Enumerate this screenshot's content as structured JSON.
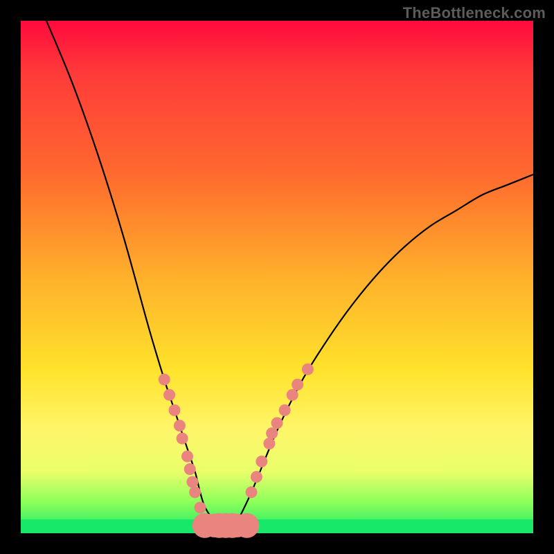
{
  "watermark": "TheBottleneck.com",
  "chart_data": {
    "type": "line",
    "title": "",
    "xlabel": "",
    "ylabel": "",
    "xlim": [
      0,
      100
    ],
    "ylim": [
      0,
      100
    ],
    "grid": false,
    "legend": false,
    "series": [
      {
        "name": "curve",
        "color": "#000000",
        "x": [
          5,
          10,
          15,
          20,
          25,
          28,
          30,
          32,
          34,
          35,
          36,
          38,
          40,
          42,
          45,
          50,
          55,
          60,
          65,
          70,
          75,
          80,
          85,
          90,
          95,
          100
        ],
        "y": [
          100,
          88,
          74,
          58,
          40,
          30,
          24,
          18,
          12,
          8,
          5,
          2,
          0,
          2,
          8,
          20,
          30,
          38,
          45,
          51,
          56,
          60,
          63,
          66,
          68,
          70
        ]
      },
      {
        "name": "dots",
        "type": "scatter",
        "color": "#e9847f",
        "markers": [
          {
            "x": 28.0,
            "y": 30.0
          },
          {
            "x": 29.0,
            "y": 27.0
          },
          {
            "x": 30.0,
            "y": 24.0
          },
          {
            "x": 31.0,
            "y": 21.0
          },
          {
            "x": 31.5,
            "y": 18.5
          },
          {
            "x": 32.5,
            "y": 15.0
          },
          {
            "x": 33.0,
            "y": 12.5
          },
          {
            "x": 33.5,
            "y": 10.0
          },
          {
            "x": 34.0,
            "y": 8.0
          },
          {
            "x": 35.0,
            "y": 5.0
          },
          {
            "x": 45.0,
            "y": 8.0
          },
          {
            "x": 46.0,
            "y": 11.0
          },
          {
            "x": 47.0,
            "y": 14.0
          },
          {
            "x": 48.5,
            "y": 17.5
          },
          {
            "x": 49.0,
            "y": 19.5
          },
          {
            "x": 50.0,
            "y": 21.5
          },
          {
            "x": 51.5,
            "y": 24.0
          },
          {
            "x": 53.0,
            "y": 27.0
          },
          {
            "x": 54.0,
            "y": 29.0
          },
          {
            "x": 56.0,
            "y": 32.0
          }
        ]
      },
      {
        "name": "bottom-cluster",
        "type": "pill",
        "color": "#e9847f",
        "x_start": 35.5,
        "x_end": 44.5,
        "y": 1.5,
        "height": 3.0
      }
    ],
    "gradient_stops": [
      {
        "y": 100,
        "color": "#ff0a3c"
      },
      {
        "y": 70,
        "color": "#ff6a2e"
      },
      {
        "y": 50,
        "color": "#ffb02b"
      },
      {
        "y": 30,
        "color": "#ffe22b"
      },
      {
        "y": 12,
        "color": "#e9ff6a"
      },
      {
        "y": 0,
        "color": "#18e86a"
      }
    ]
  }
}
